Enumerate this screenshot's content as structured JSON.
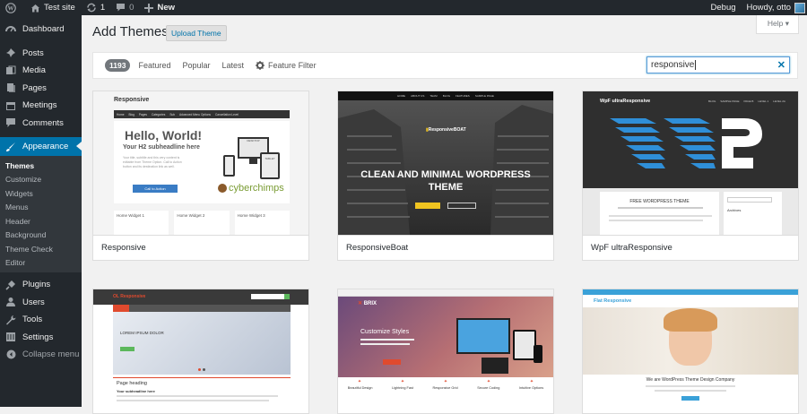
{
  "adminbar": {
    "site": "Test site",
    "updates": "1",
    "comments": "0",
    "new": "New",
    "debug": "Debug",
    "howdy": "Howdy, otto"
  },
  "menu": {
    "dashboard": "Dashboard",
    "posts": "Posts",
    "media": "Media",
    "pages": "Pages",
    "meetings": "Meetings",
    "comments": "Comments",
    "appearance": "Appearance",
    "sub": {
      "themes": "Themes",
      "customize": "Customize",
      "widgets": "Widgets",
      "menus": "Menus",
      "header": "Header",
      "background": "Background",
      "theme_check": "Theme Check",
      "editor": "Editor"
    },
    "plugins": "Plugins",
    "users": "Users",
    "tools": "Tools",
    "settings": "Settings",
    "collapse": "Collapse menu"
  },
  "page": {
    "title": "Add Themes",
    "upload": "Upload Theme",
    "help": "Help ▾"
  },
  "filter": {
    "count": "1193",
    "featured": "Featured",
    "popular": "Popular",
    "latest": "Latest",
    "feature_filter": "Feature Filter",
    "search_value": "responsive"
  },
  "themes": [
    {
      "name": "Responsive",
      "shot": {
        "brand": "Responsive",
        "nav": [
          "Home",
          "Blog",
          "Pages",
          "Categories",
          "Sub",
          "Advanced Menu Options",
          "Cancellation Level"
        ],
        "headline": "Hello, World!",
        "sub": "Your H2 subheadline here",
        "cta": "Call to Action",
        "widgets": [
          "Home Widget 1",
          "Home Widget 2",
          "Home Widget 3"
        ],
        "logo": "cyberchimps",
        "devices": [
          "DESKTOP",
          "TABLET"
        ]
      }
    },
    {
      "name": "ResponsiveBoat",
      "shot": {
        "brand": "ResponsiveBOAT",
        "headline": "CLEAN AND MINIMAL WORDPRESS THEME",
        "nav": [
          "HOME",
          "ABOUT US",
          "TEAM",
          "BLOG",
          "FEATURES",
          "SAMPLE PAGE"
        ]
      }
    },
    {
      "name": "WpF ultraResponsive",
      "shot": {
        "brand": "WpF ultraResponsive",
        "nav": [
          "BLOG",
          "SAMPLE PAGE",
          "PAGE B",
          "LEVEL 1",
          "LEVEL 2A"
        ],
        "post_title": "FREE WORDPRESS THEME",
        "archives": "Archives"
      }
    },
    {
      "name": "",
      "shot": {
        "brand": "OL Responsive",
        "hero": "LOREM IPSUM DOLOR",
        "heading": "Page heading",
        "sub": "Your subheadline here"
      }
    },
    {
      "name": "",
      "shot": {
        "brand": "BRIX",
        "title": "Customize Styles",
        "features": [
          "Beautiful Design",
          "Lightning Fast",
          "Responsive Grid",
          "Secure Coding",
          "Intuitive Options"
        ]
      }
    },
    {
      "name": "",
      "shot": {
        "brand": "Flat Responsive",
        "tagline": "We are WordPress Theme Design Company"
      }
    }
  ]
}
